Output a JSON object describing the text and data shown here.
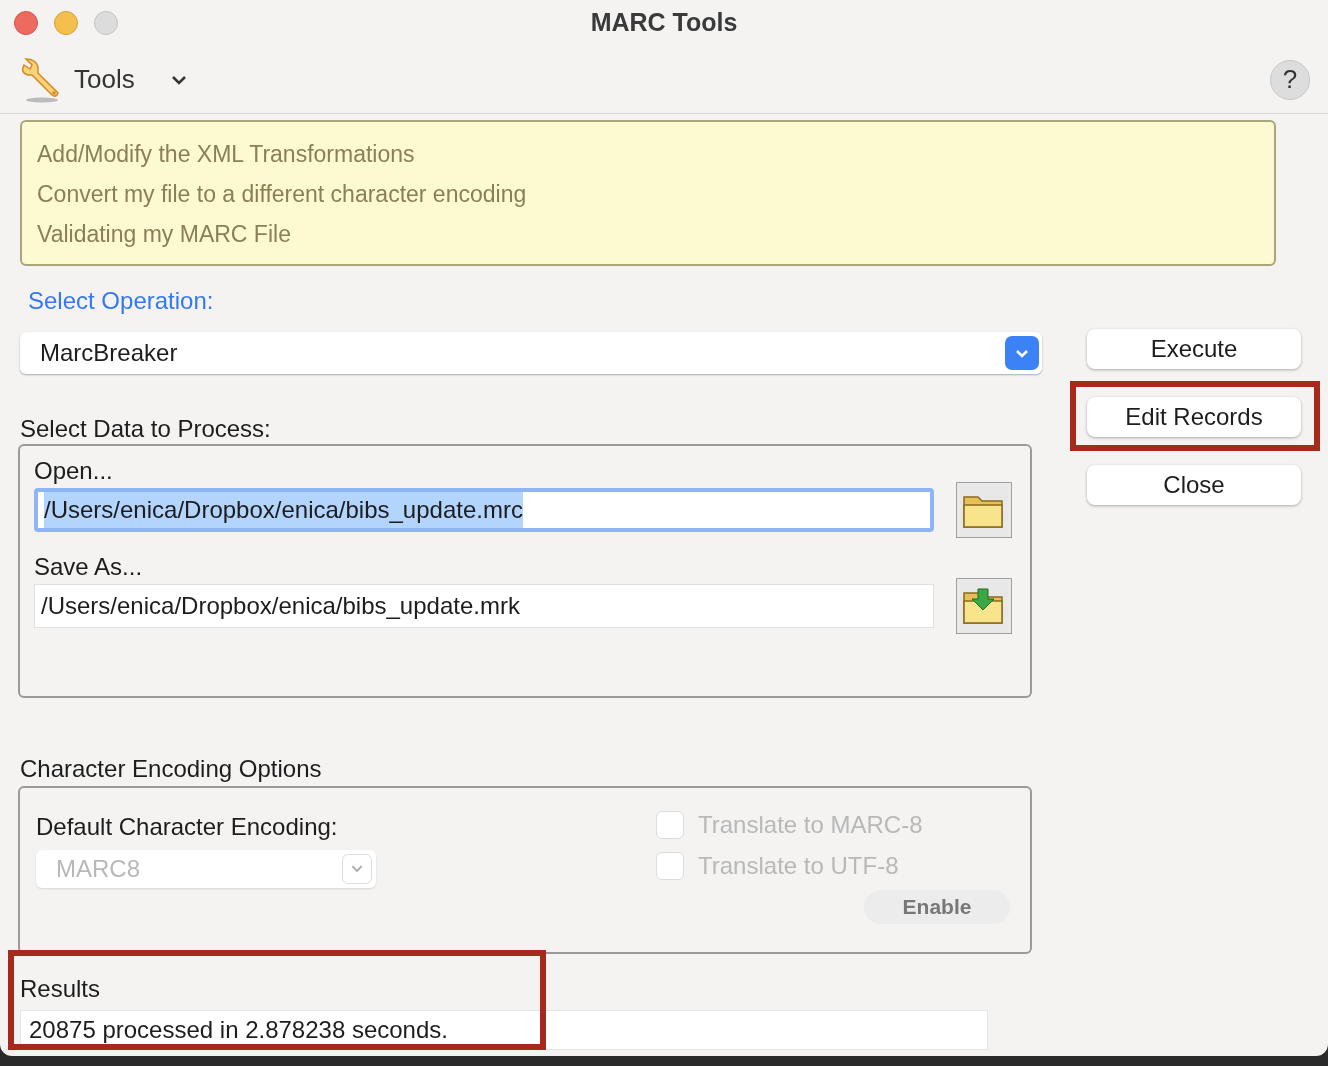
{
  "window": {
    "title": "MARC Tools"
  },
  "toolbar": {
    "menu_label": "Tools",
    "help": "?"
  },
  "info_links": [
    "Add/Modify the XML Transformations",
    "Convert my file to a different character encoding",
    "Validating my MARC File"
  ],
  "operation": {
    "label": "Select Operation:",
    "value": "MarcBreaker"
  },
  "buttons": [
    {
      "label": "Execute",
      "highlighted": false
    },
    {
      "label": "Edit Records",
      "highlighted": true
    },
    {
      "label": "Close",
      "highlighted": false
    }
  ],
  "data": {
    "label": "Select Data to Process:",
    "fields": [
      {
        "label": "Open...",
        "value": "/Users/enica/Dropbox/enica/bibs_update.mrc",
        "selected": true,
        "kind": "open"
      },
      {
        "label": "Save As...",
        "value": "/Users/enica/Dropbox/enica/bibs_update.mrk",
        "selected": false,
        "kind": "save"
      }
    ]
  },
  "encoding": {
    "label": "Character Encoding Options",
    "default_label": "Default Character Encoding:",
    "default_value": "MARC8",
    "disabled": true,
    "options": [
      {
        "label": "Translate to MARC-8",
        "checked": false,
        "disabled": true
      },
      {
        "label": "Translate to UTF-8",
        "checked": false,
        "disabled": true
      }
    ],
    "enable_button": "Enable"
  },
  "results": {
    "label": "Results",
    "value": "20875 processed in 2.878238 seconds.",
    "highlighted": true
  }
}
